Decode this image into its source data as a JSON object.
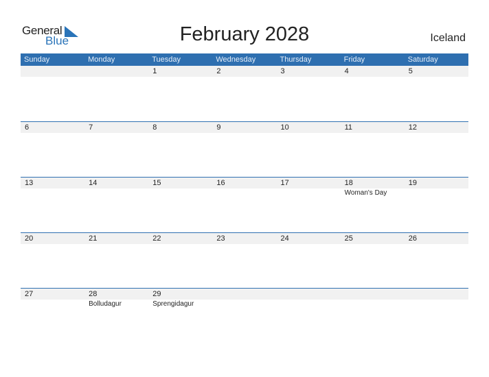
{
  "logo": {
    "word1": "General",
    "word2": "Blue"
  },
  "title": "February 2028",
  "country": "Iceland",
  "days": [
    "Sunday",
    "Monday",
    "Tuesday",
    "Wednesday",
    "Thursday",
    "Friday",
    "Saturday"
  ],
  "weeks": [
    {
      "dates": [
        "",
        "",
        "1",
        "2",
        "3",
        "4",
        "5"
      ],
      "holidays": [
        "",
        "",
        "",
        "",
        "",
        "",
        ""
      ]
    },
    {
      "dates": [
        "6",
        "7",
        "8",
        "9",
        "10",
        "11",
        "12"
      ],
      "holidays": [
        "",
        "",
        "",
        "",
        "",
        "",
        ""
      ]
    },
    {
      "dates": [
        "13",
        "14",
        "15",
        "16",
        "17",
        "18",
        "19"
      ],
      "holidays": [
        "",
        "",
        "",
        "",
        "",
        "Woman's Day",
        ""
      ]
    },
    {
      "dates": [
        "20",
        "21",
        "22",
        "23",
        "24",
        "25",
        "26"
      ],
      "holidays": [
        "",
        "",
        "",
        "",
        "",
        "",
        ""
      ]
    },
    {
      "dates": [
        "27",
        "28",
        "29",
        "",
        "",
        "",
        ""
      ],
      "holidays": [
        "",
        "Bolludagur",
        "Sprengidagur",
        "",
        "",
        "",
        ""
      ]
    }
  ],
  "colors": {
    "accent": "#2e6fb0",
    "date_row_bg": "#f1f1f1",
    "logo_blue": "#2a74b9"
  }
}
